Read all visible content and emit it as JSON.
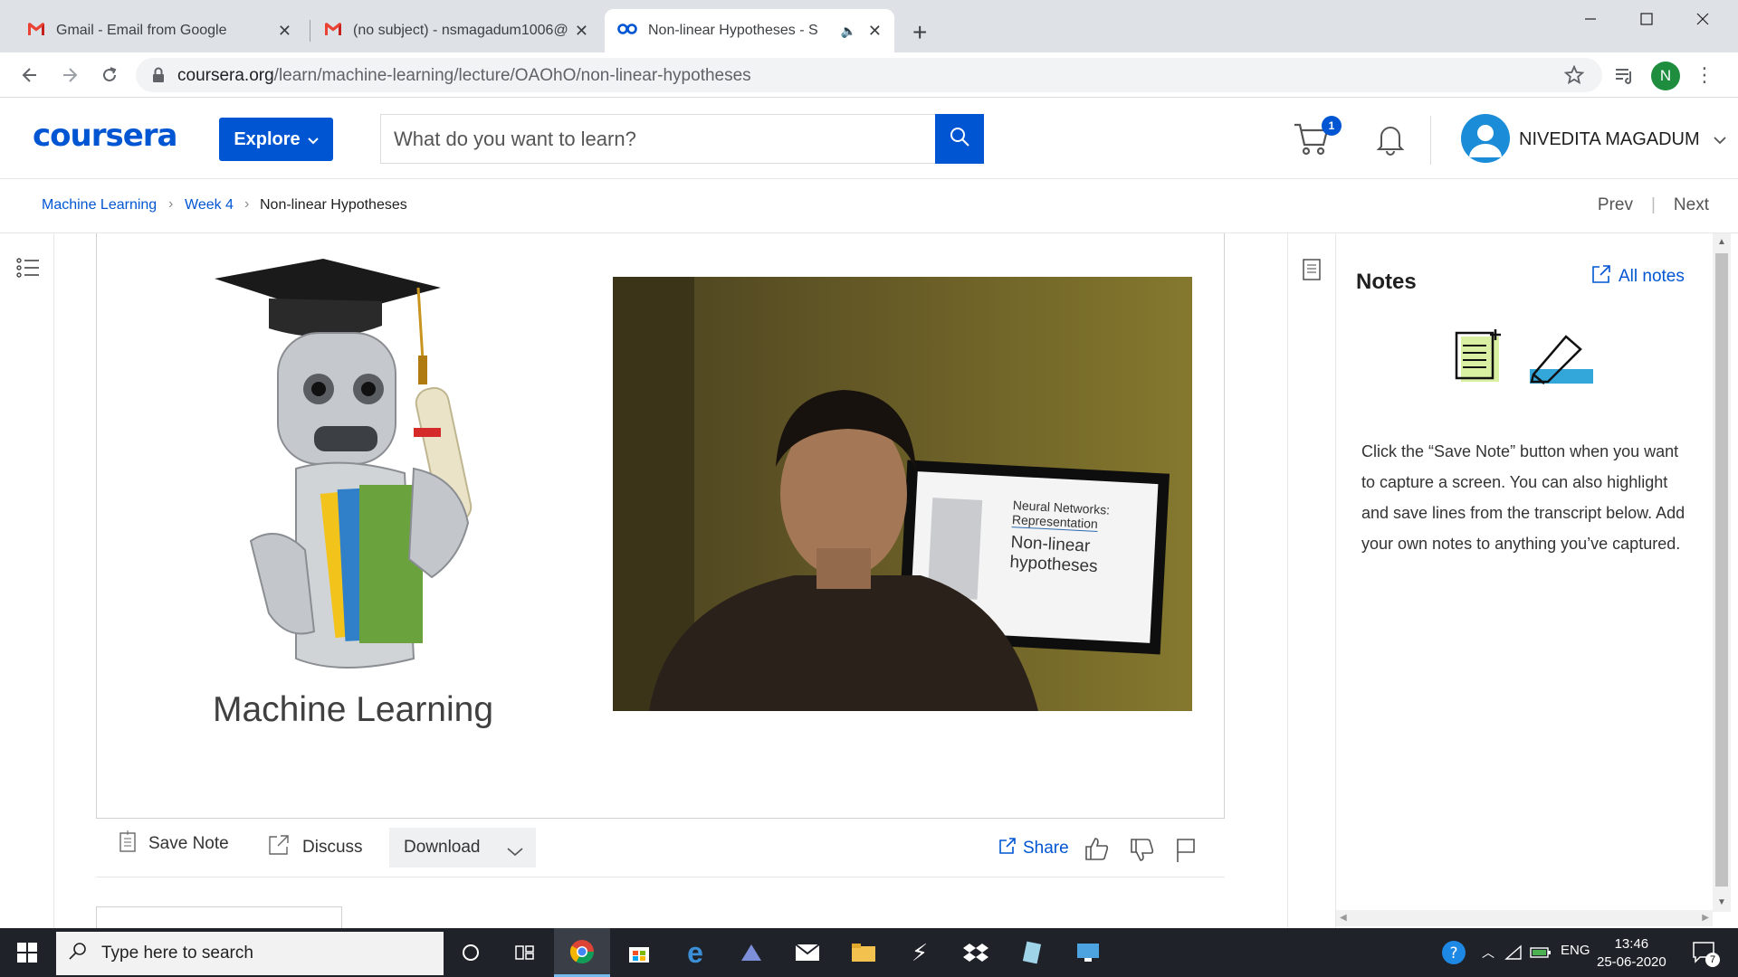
{
  "browser": {
    "tabs": [
      {
        "title": "Gmail - Email from Google",
        "icon": "gmail-icon"
      },
      {
        "title": "(no subject) - nsmagadum1006@",
        "icon": "gmail-icon"
      },
      {
        "title": "Non-linear Hypotheses - Star",
        "icon": "coursera-icon",
        "active": true
      }
    ],
    "url_host": "coursera.org",
    "url_path": "/learn/machine-learning/lecture/OAOhO/non-linear-hypotheses",
    "profile_initial": "N"
  },
  "header": {
    "logo": "coursera",
    "explore_label": "Explore",
    "search_placeholder": "What do you want to learn?",
    "cart_count": "1",
    "user_name": "NIVEDITA MAGADUM"
  },
  "breadcrumb": {
    "items": [
      "Machine Learning",
      "Week 4",
      "Non-linear Hypotheses"
    ],
    "prev_label": "Prev",
    "next_label": "Next"
  },
  "video": {
    "caption": "Machine Learning",
    "slide_title": "Neural Networks:",
    "slide_subtitle": "Representation",
    "slide_topic_line1": "Non-linear",
    "slide_topic_line2": "hypotheses"
  },
  "actions": {
    "save_note": "Save Note",
    "discuss": "Discuss",
    "download": "Download",
    "share": "Share"
  },
  "notes": {
    "title": "Notes",
    "all_notes": "All notes",
    "body": "Click the “Save Note” button when you want to capture a screen. You can also highlight and save lines from the transcript below. Add your own notes to anything you’ve captured."
  },
  "taskbar": {
    "search_placeholder": "Type here to search",
    "language": "ENG",
    "time": "13:46",
    "date": "25-06-2020",
    "notification_count": "7"
  },
  "colors": {
    "brand": "#0056d2",
    "chrome_frame": "#dee1e6",
    "taskbar": "#1f2329"
  }
}
